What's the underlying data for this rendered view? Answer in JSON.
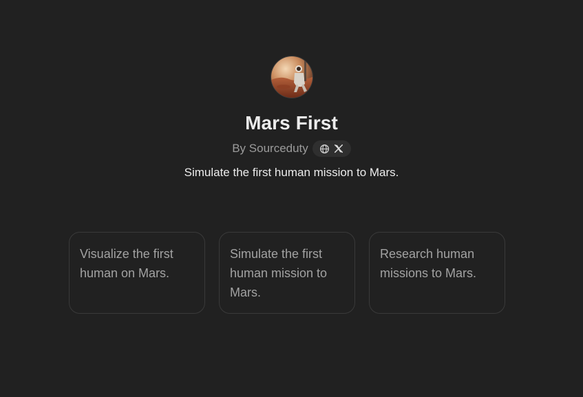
{
  "gpt": {
    "avatar_icon": "astronaut-on-mars-avatar",
    "title": "Mars First",
    "byline": "By Sourceduty",
    "link_icons": [
      "globe-icon",
      "x-icon"
    ],
    "description": "Simulate the first human mission to Mars."
  },
  "prompts": [
    {
      "text": "Visualize the first human on Mars."
    },
    {
      "text": "Simulate the first human mission to Mars."
    },
    {
      "text": "Research human missions to Mars."
    }
  ],
  "colors": {
    "background": "#212121",
    "title": "#ececec",
    "muted": "#9b9b9b",
    "card_border": "#3a3a3a",
    "pill_background": "#2f2f2f"
  }
}
